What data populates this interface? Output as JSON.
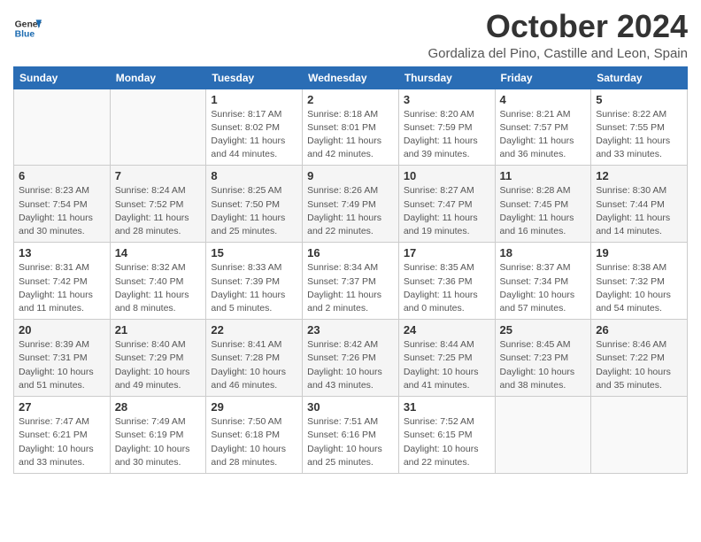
{
  "logo": {
    "text_general": "General",
    "text_blue": "Blue"
  },
  "title": "October 2024",
  "subtitle": "Gordaliza del Pino, Castille and Leon, Spain",
  "headers": [
    "Sunday",
    "Monday",
    "Tuesday",
    "Wednesday",
    "Thursday",
    "Friday",
    "Saturday"
  ],
  "weeks": [
    [
      {
        "day": "",
        "info": ""
      },
      {
        "day": "",
        "info": ""
      },
      {
        "day": "1",
        "info": "Sunrise: 8:17 AM\nSunset: 8:02 PM\nDaylight: 11 hours and 44 minutes."
      },
      {
        "day": "2",
        "info": "Sunrise: 8:18 AM\nSunset: 8:01 PM\nDaylight: 11 hours and 42 minutes."
      },
      {
        "day": "3",
        "info": "Sunrise: 8:20 AM\nSunset: 7:59 PM\nDaylight: 11 hours and 39 minutes."
      },
      {
        "day": "4",
        "info": "Sunrise: 8:21 AM\nSunset: 7:57 PM\nDaylight: 11 hours and 36 minutes."
      },
      {
        "day": "5",
        "info": "Sunrise: 8:22 AM\nSunset: 7:55 PM\nDaylight: 11 hours and 33 minutes."
      }
    ],
    [
      {
        "day": "6",
        "info": "Sunrise: 8:23 AM\nSunset: 7:54 PM\nDaylight: 11 hours and 30 minutes."
      },
      {
        "day": "7",
        "info": "Sunrise: 8:24 AM\nSunset: 7:52 PM\nDaylight: 11 hours and 28 minutes."
      },
      {
        "day": "8",
        "info": "Sunrise: 8:25 AM\nSunset: 7:50 PM\nDaylight: 11 hours and 25 minutes."
      },
      {
        "day": "9",
        "info": "Sunrise: 8:26 AM\nSunset: 7:49 PM\nDaylight: 11 hours and 22 minutes."
      },
      {
        "day": "10",
        "info": "Sunrise: 8:27 AM\nSunset: 7:47 PM\nDaylight: 11 hours and 19 minutes."
      },
      {
        "day": "11",
        "info": "Sunrise: 8:28 AM\nSunset: 7:45 PM\nDaylight: 11 hours and 16 minutes."
      },
      {
        "day": "12",
        "info": "Sunrise: 8:30 AM\nSunset: 7:44 PM\nDaylight: 11 hours and 14 minutes."
      }
    ],
    [
      {
        "day": "13",
        "info": "Sunrise: 8:31 AM\nSunset: 7:42 PM\nDaylight: 11 hours and 11 minutes."
      },
      {
        "day": "14",
        "info": "Sunrise: 8:32 AM\nSunset: 7:40 PM\nDaylight: 11 hours and 8 minutes."
      },
      {
        "day": "15",
        "info": "Sunrise: 8:33 AM\nSunset: 7:39 PM\nDaylight: 11 hours and 5 minutes."
      },
      {
        "day": "16",
        "info": "Sunrise: 8:34 AM\nSunset: 7:37 PM\nDaylight: 11 hours and 2 minutes."
      },
      {
        "day": "17",
        "info": "Sunrise: 8:35 AM\nSunset: 7:36 PM\nDaylight: 11 hours and 0 minutes."
      },
      {
        "day": "18",
        "info": "Sunrise: 8:37 AM\nSunset: 7:34 PM\nDaylight: 10 hours and 57 minutes."
      },
      {
        "day": "19",
        "info": "Sunrise: 8:38 AM\nSunset: 7:32 PM\nDaylight: 10 hours and 54 minutes."
      }
    ],
    [
      {
        "day": "20",
        "info": "Sunrise: 8:39 AM\nSunset: 7:31 PM\nDaylight: 10 hours and 51 minutes."
      },
      {
        "day": "21",
        "info": "Sunrise: 8:40 AM\nSunset: 7:29 PM\nDaylight: 10 hours and 49 minutes."
      },
      {
        "day": "22",
        "info": "Sunrise: 8:41 AM\nSunset: 7:28 PM\nDaylight: 10 hours and 46 minutes."
      },
      {
        "day": "23",
        "info": "Sunrise: 8:42 AM\nSunset: 7:26 PM\nDaylight: 10 hours and 43 minutes."
      },
      {
        "day": "24",
        "info": "Sunrise: 8:44 AM\nSunset: 7:25 PM\nDaylight: 10 hours and 41 minutes."
      },
      {
        "day": "25",
        "info": "Sunrise: 8:45 AM\nSunset: 7:23 PM\nDaylight: 10 hours and 38 minutes."
      },
      {
        "day": "26",
        "info": "Sunrise: 8:46 AM\nSunset: 7:22 PM\nDaylight: 10 hours and 35 minutes."
      }
    ],
    [
      {
        "day": "27",
        "info": "Sunrise: 7:47 AM\nSunset: 6:21 PM\nDaylight: 10 hours and 33 minutes."
      },
      {
        "day": "28",
        "info": "Sunrise: 7:49 AM\nSunset: 6:19 PM\nDaylight: 10 hours and 30 minutes."
      },
      {
        "day": "29",
        "info": "Sunrise: 7:50 AM\nSunset: 6:18 PM\nDaylight: 10 hours and 28 minutes."
      },
      {
        "day": "30",
        "info": "Sunrise: 7:51 AM\nSunset: 6:16 PM\nDaylight: 10 hours and 25 minutes."
      },
      {
        "day": "31",
        "info": "Sunrise: 7:52 AM\nSunset: 6:15 PM\nDaylight: 10 hours and 22 minutes."
      },
      {
        "day": "",
        "info": ""
      },
      {
        "day": "",
        "info": ""
      }
    ]
  ]
}
